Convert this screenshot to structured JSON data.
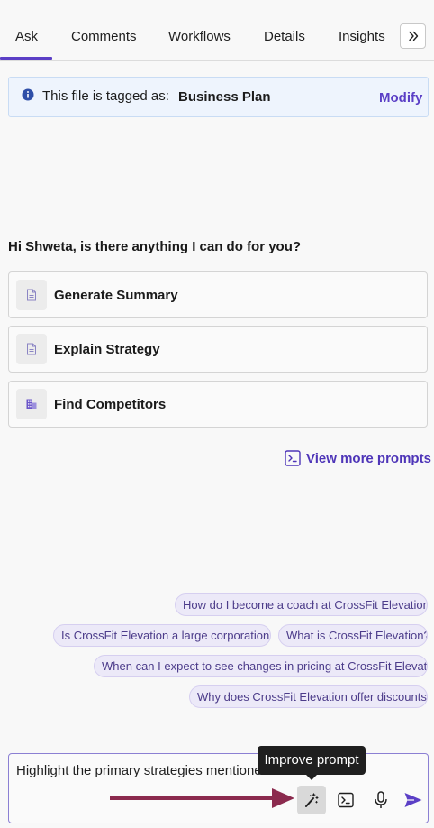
{
  "tabs": [
    {
      "label": "Ask",
      "active": true
    },
    {
      "label": "Comments",
      "active": false
    },
    {
      "label": "Workflows",
      "active": false
    },
    {
      "label": "Details",
      "active": false
    },
    {
      "label": "Insights",
      "active": false
    }
  ],
  "tab_more_icon": "double-chevron-right-icon",
  "tag_banner": {
    "icon": "info-icon",
    "label": "This file is tagged as:",
    "value": "Business Plan",
    "action": "Modify"
  },
  "greeting": "Hi Shweta, is there anything I can do for you?",
  "prompt_cards": [
    {
      "label": "Generate Summary",
      "icon": "document-icon"
    },
    {
      "label": "Explain Strategy",
      "icon": "document-icon"
    },
    {
      "label": "Find Competitors",
      "icon": "building-icon"
    }
  ],
  "view_more": {
    "label": "View more prompts",
    "icon": "terminal-prompt-icon"
  },
  "suggestions": [
    "How do I become a coach at CrossFit Elevation?",
    "Is CrossFit Elevation a large corporation?",
    "What is CrossFit Elevation?",
    "When can I expect to see changes in pricing at CrossFit Elevati...",
    "Why does CrossFit Elevation offer discounts?"
  ],
  "input": {
    "value": "Highlight the primary strategies mentioned"
  },
  "toolbar": {
    "improve_icon": "magic-wand-icon",
    "prompts_icon": "terminal-prompt-icon",
    "mic_icon": "microphone-icon",
    "send_icon": "send-icon"
  },
  "tooltip": "Improve prompt",
  "colors": {
    "accent": "#5b3fc6",
    "annotation_arrow": "#8b2a4e",
    "banner_bg": "#eef4fd",
    "chip_bg": "#ece9f8"
  }
}
